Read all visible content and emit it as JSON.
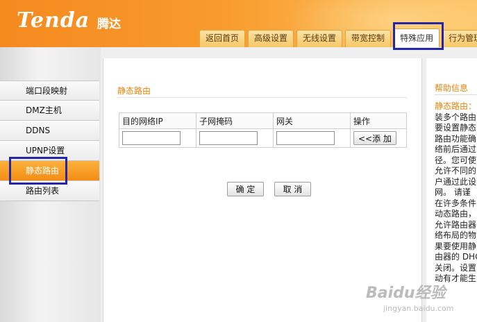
{
  "header": {
    "logo": "Tenda",
    "logo_cn": "腾达",
    "tabs": [
      {
        "label": "返回首页"
      },
      {
        "label": "高级设置"
      },
      {
        "label": "无线设置"
      },
      {
        "label": "带宽控制"
      },
      {
        "label": "特殊应用",
        "active": true
      },
      {
        "label": "行为管理"
      }
    ]
  },
  "sidebar": {
    "items": [
      {
        "label": "端口段映射"
      },
      {
        "label": "DMZ主机"
      },
      {
        "label": "DDNS"
      },
      {
        "label": "UPNP设置"
      },
      {
        "label": "静态路由",
        "active": true
      },
      {
        "label": "路由列表"
      }
    ]
  },
  "main": {
    "title": "静态路由",
    "table": {
      "headers": [
        "目的网络IP",
        "子网掩码",
        "网关",
        "操作"
      ],
      "row": {
        "ip": "",
        "mask": "",
        "gateway": ""
      },
      "add_label": "<<添 加"
    },
    "confirm_label": "确 定",
    "cancel_label": "取 消"
  },
  "help": {
    "title": "帮助信息",
    "label": "静态路由：",
    "lines": [
      "装多个路由",
      "要设置静态",
      "路由功能确",
      "络前后通过",
      "径。您可使",
      "允许不同的",
      "户通过此设",
      "网。 请谨",
      "在许多条件",
      "动态路由，",
      "允许路由器",
      "络布局的物",
      "果要使用静",
      "由器的 DHC",
      "关闭。设置",
      "动有才能生"
    ]
  },
  "watermark": {
    "text": "Baidu经验",
    "sub": "jingyan.baidu.com"
  },
  "colors": {
    "accent": "#f48d14",
    "title": "#e5850b",
    "highlight_box": "#2326a8"
  }
}
